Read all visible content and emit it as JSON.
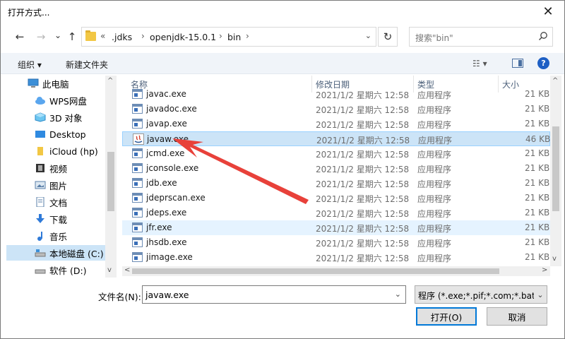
{
  "window": {
    "title": "打开方式...",
    "close_glyph": "✕"
  },
  "nav": {
    "back_glyph": "←",
    "forward_glyph": "→",
    "dropdown_glyph": "⌄",
    "up_glyph": "↑",
    "crumbs": [
      "«",
      ".jdks",
      "›",
      "openjdk-15.0.1",
      "›",
      "bin",
      "›"
    ],
    "address_dd_glyph": "⌄",
    "refresh_glyph": "↻",
    "search_placeholder": "搜索\"bin\""
  },
  "toolbar": {
    "organize_label": "组织 ▾",
    "new_folder_label": "新建文件夹",
    "view_glyph": "☷ ▾",
    "help_glyph": "?"
  },
  "sidebar": {
    "items": [
      {
        "label": "此电脑",
        "icon": "computer-icon"
      },
      {
        "label": "WPS网盘",
        "icon": "cloud-icon"
      },
      {
        "label": "3D 对象",
        "icon": "cube-icon"
      },
      {
        "label": "Desktop",
        "icon": "desktop-icon"
      },
      {
        "label": "iCloud (hp)",
        "icon": "folder-icon"
      },
      {
        "label": "视频",
        "icon": "video-icon"
      },
      {
        "label": "图片",
        "icon": "picture-icon"
      },
      {
        "label": "文档",
        "icon": "document-icon"
      },
      {
        "label": "下载",
        "icon": "download-icon"
      },
      {
        "label": "音乐",
        "icon": "music-icon"
      },
      {
        "label": "本地磁盘 (C:)",
        "icon": "drive-icon"
      },
      {
        "label": "软件 (D:)",
        "icon": "drive-icon"
      }
    ],
    "selected_index": 10,
    "scroll_up": "^",
    "scroll_down": "v"
  },
  "columns": {
    "name": "名称",
    "date": "修改日期",
    "type": "类型",
    "size": "大小",
    "sort_glyph": "^"
  },
  "files": [
    {
      "name": "javac.exe",
      "date": "2021/1/2 星期六 12:58",
      "type": "应用程序",
      "size": "21 KB",
      "icon": "exe-icon"
    },
    {
      "name": "javadoc.exe",
      "date": "2021/1/2 星期六 12:58",
      "type": "应用程序",
      "size": "21 KB",
      "icon": "exe-icon"
    },
    {
      "name": "javap.exe",
      "date": "2021/1/2 星期六 12:58",
      "type": "应用程序",
      "size": "21 KB",
      "icon": "exe-icon"
    },
    {
      "name": "javaw.exe",
      "date": "2021/1/2 星期六 12:58",
      "type": "应用程序",
      "size": "46 KB",
      "icon": "java-icon"
    },
    {
      "name": "jcmd.exe",
      "date": "2021/1/2 星期六 12:58",
      "type": "应用程序",
      "size": "21 KB",
      "icon": "exe-icon"
    },
    {
      "name": "jconsole.exe",
      "date": "2021/1/2 星期六 12:58",
      "type": "应用程序",
      "size": "21 KB",
      "icon": "exe-icon"
    },
    {
      "name": "jdb.exe",
      "date": "2021/1/2 星期六 12:58",
      "type": "应用程序",
      "size": "21 KB",
      "icon": "exe-icon"
    },
    {
      "name": "jdeprscan.exe",
      "date": "2021/1/2 星期六 12:58",
      "type": "应用程序",
      "size": "21 KB",
      "icon": "exe-icon"
    },
    {
      "name": "jdeps.exe",
      "date": "2021/1/2 星期六 12:58",
      "type": "应用程序",
      "size": "21 KB",
      "icon": "exe-icon"
    },
    {
      "name": "jfr.exe",
      "date": "2021/1/2 星期六 12:58",
      "type": "应用程序",
      "size": "21 KB",
      "icon": "exe-icon"
    },
    {
      "name": "jhsdb.exe",
      "date": "2021/1/2 星期六 12:58",
      "type": "应用程序",
      "size": "21 KB",
      "icon": "exe-icon"
    },
    {
      "name": "jimage.exe",
      "date": "2021/1/2 星期六 12:58",
      "type": "应用程序",
      "size": "21 KB",
      "icon": "exe-icon"
    }
  ],
  "selected_file_index": 3,
  "hover_file_index": 9,
  "hscroll": {
    "left": "<",
    "right": ">"
  },
  "vscroll": {
    "up": "^",
    "down": "v"
  },
  "bottom": {
    "filename_label": "文件名(N):",
    "filename_value": "javaw.exe",
    "filename_dd": "⌄",
    "filetype_value": "程序 (*.exe;*.pif;*.com;*.bat;*.cmd)",
    "filetype_dd": "⌄",
    "open_label": "打开(O)",
    "cancel_label": "取消"
  },
  "colors": {
    "accent": "#0078d7",
    "selection": "#cce4f7",
    "annotation_arrow": "#e8413a"
  }
}
